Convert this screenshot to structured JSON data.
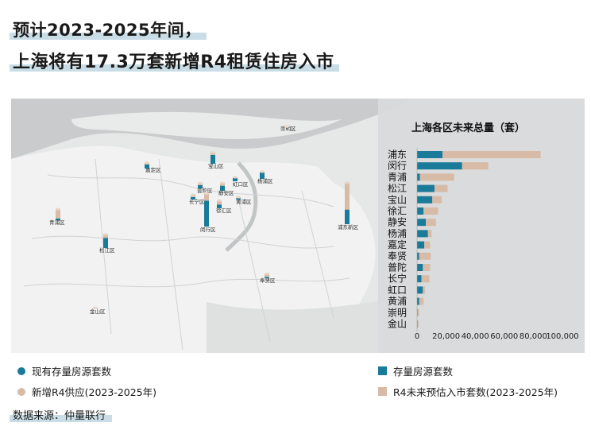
{
  "title": {
    "line1": "预计2023-2025年间，",
    "line2": "上海将有17.3万套新增R4租赁住房入市"
  },
  "map": {
    "district_labels": [
      "崇明区",
      "嘉定区",
      "宝山区",
      "杨浦区",
      "虹口区",
      "普陀区",
      "静安区",
      "长宁区",
      "黄浦区",
      "徐汇区",
      "闵行区",
      "浦东新区",
      "青浦区",
      "松江区",
      "奉贤区",
      "金山区"
    ],
    "legend_existing": "现有存量房源套数",
    "legend_new": "新增R4供应(2023-2025年)",
    "colors": {
      "existing": "#1a7a9a",
      "new": "#d8bba6",
      "land": "#f3f3f3",
      "water": "#c5c8c9",
      "sea": "#d8d9da"
    }
  },
  "chart_data": {
    "type": "bar",
    "title": "上海各区未来总量（套）",
    "categories": [
      "浦东",
      "闵行",
      "青浦",
      "松江",
      "宝山",
      "徐汇",
      "静安",
      "杨浦",
      "嘉定",
      "奉贤",
      "普陀",
      "长宁",
      "虹口",
      "黄浦",
      "崇明",
      "金山"
    ],
    "series": [
      {
        "name": "存量房源套数",
        "color": "#1a7a9a",
        "values": [
          17500,
          31000,
          2000,
          12000,
          10500,
          4500,
          6000,
          7500,
          5000,
          1500,
          4000,
          3000,
          4000,
          1500,
          300,
          300
        ]
      },
      {
        "name": "R4未来预估入市套数(2023-2025年)",
        "color": "#d8bba6",
        "values": [
          67500,
          18000,
          23500,
          9000,
          6500,
          10000,
          7000,
          2500,
          4000,
          8000,
          5000,
          5500,
          1500,
          3000,
          1200,
          800
        ]
      }
    ],
    "stacked": true,
    "orientation": "horizontal",
    "xlim": [
      0,
      100000
    ],
    "xticks": [
      "0",
      "20,000",
      "40,000",
      "60,000",
      "80,000",
      "100,000"
    ]
  },
  "source": "数据来源：仲量联行"
}
